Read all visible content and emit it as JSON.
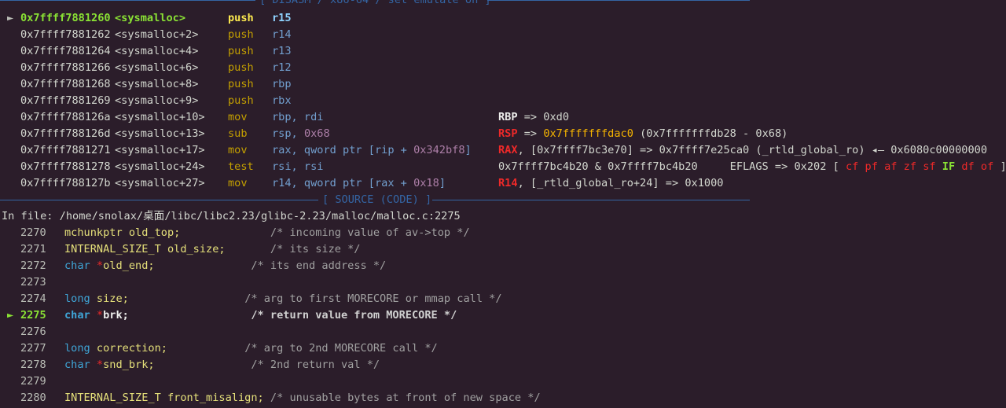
{
  "disasm_header": "[ DISASM / x86-64 / set emulate on ]",
  "source_header": "[ SOURCE (CODE) ]",
  "current_marker": "►",
  "disasm": [
    {
      "addr": "0x7ffff7881260",
      "sym": "<sysmalloc>",
      "mn": "push",
      "op1": "r15",
      "op2": "",
      "extra": "",
      "current": true
    },
    {
      "addr": "0x7ffff7881262",
      "sym": "<sysmalloc+2>",
      "mn": "push",
      "op1": "r14"
    },
    {
      "addr": "0x7ffff7881264",
      "sym": "<sysmalloc+4>",
      "mn": "push",
      "op1": "r13"
    },
    {
      "addr": "0x7ffff7881266",
      "sym": "<sysmalloc+6>",
      "mn": "push",
      "op1": "r12"
    },
    {
      "addr": "0x7ffff7881268",
      "sym": "<sysmalloc+8>",
      "mn": "push",
      "op1": "rbp"
    },
    {
      "addr": "0x7ffff7881269",
      "sym": "<sysmalloc+9>",
      "mn": "push",
      "op1": "rbx"
    },
    {
      "addr": "0x7ffff788126a",
      "sym": "<sysmalloc+10>",
      "mn": "mov",
      "op1": "rbp, rdi"
    },
    {
      "addr": "0x7ffff788126d",
      "sym": "<sysmalloc+13>",
      "mn": "sub",
      "op1": "rsp,",
      "op_num": "0x68"
    },
    {
      "addr": "0x7ffff7881271",
      "sym": "<sysmalloc+17>",
      "mn": "mov",
      "op1": "rax, qword ptr [rip + ",
      "op_num": "0x342bf8",
      "op_tail": "]"
    },
    {
      "addr": "0x7ffff7881278",
      "sym": "<sysmalloc+24>",
      "mn": "test",
      "op1": "rsi, rsi"
    },
    {
      "addr": "0x7ffff788127b",
      "sym": "<sysmalloc+27>",
      "mn": "mov",
      "op1": "r14, qword ptr [rax + ",
      "op_num": "0x18",
      "op_tail": "]"
    }
  ],
  "annotations": {
    "rbp_reg": "RBP",
    "rbp_rest": " => 0xd0",
    "rsp_reg": "RSP",
    "rsp_arrow": " => ",
    "rsp_val": "0x7fffffffdac0",
    "rsp_rest": " (0x7fffffffdb28 - 0x68)",
    "rax_reg": "RAX",
    "rax_rest": ", [0x7ffff7bc3e70] => 0x7ffff7e25ca0 (_rtld_global_ro) ◂— 0x6080c00000000",
    "test_rest": "0x7ffff7bc4b20 & 0x7ffff7bc4b20     EFLAGS => 0x202 [",
    "flags": [
      "cf",
      "pf",
      "af",
      "zf",
      "sf"
    ],
    "flag_if": "IF",
    "flags2": [
      "df",
      "of"
    ],
    "flag_close": "]",
    "r14_reg": "R14",
    "r14_rest": ", [_rtld_global_ro+24] => 0x1000"
  },
  "in_file_label": "In file: ",
  "in_file_path": "/home/snolax/桌面/libc/libc2.23/glibc-2.23/malloc/malloc.c:2275",
  "source": [
    {
      "ln": "2270",
      "type": "mchunkptr",
      "ptr": "",
      "name": " old_top;",
      "pad": "              ",
      "comment": "/* incoming value of av->top */"
    },
    {
      "ln": "2271",
      "type": "INTERNAL_SIZE_T",
      "ptr": "",
      "name": " old_size;",
      "pad": "       ",
      "comment": "/* its size */"
    },
    {
      "ln": "2272",
      "type": "char",
      "kw": true,
      "ptr": " *",
      "name": "old_end;",
      "pad": "               ",
      "comment": "/* its end address */"
    },
    {
      "ln": "2273",
      "type": "",
      "name": "",
      "comment": ""
    },
    {
      "ln": "2274",
      "type": "long",
      "kw": true,
      "ptr": "",
      "name": " size;",
      "pad": "                  ",
      "comment": "/* arg to first MORECORE or mmap call */"
    },
    {
      "ln": "2275",
      "type": "char",
      "kw": true,
      "ptr": " *",
      "name": "brk;",
      "pad": "                   ",
      "comment": "/* return value from MORECORE */",
      "current": true
    },
    {
      "ln": "2276",
      "type": "",
      "name": "",
      "comment": ""
    },
    {
      "ln": "2277",
      "type": "long",
      "kw": true,
      "ptr": "",
      "name": " correction;",
      "pad": "            ",
      "comment": "/* arg to 2nd MORECORE call */"
    },
    {
      "ln": "2278",
      "type": "char",
      "kw": true,
      "ptr": " *",
      "name": "snd_brk;",
      "pad": "               ",
      "comment": "/* 2nd return val */"
    },
    {
      "ln": "2279",
      "type": "",
      "name": "",
      "comment": ""
    },
    {
      "ln": "2280",
      "type": "INTERNAL_SIZE_T",
      "ptr": "",
      "name": " front_misalign;",
      "pad": " ",
      "comment": "/* unusable bytes at front of new space */"
    }
  ]
}
